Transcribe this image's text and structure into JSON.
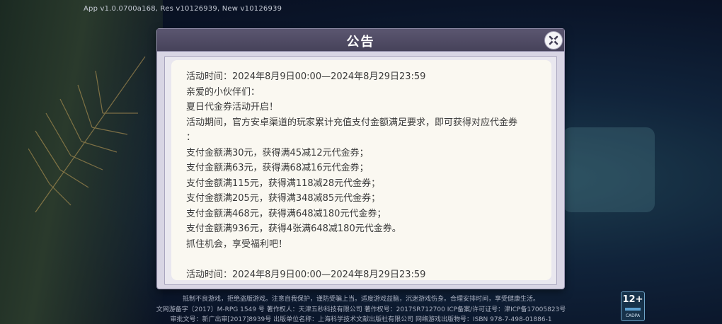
{
  "app": {
    "version_text": "App v1.0.0700a168, Res v10126939, New v10126939"
  },
  "dialog": {
    "title": "公告",
    "close_icon": "close-x-icon",
    "lines": [
      "活动时间：2024年8月9日00:00—2024年8月29日23:59",
      "亲爱的小伙伴们：",
      "夏日代金券活动开启！",
      "活动期间，官方安卓渠道的玩家累计充值支付金额满足要求，即可获得对应代金券",
      "：",
      "支付金额满30元，获得满45减12元代金券；",
      "支付金额满63元，获得满68减16元代金券；",
      "支付金额满115元，获得满118减28元代金券；",
      "支付金额满205元，获得满348减85元代金券；",
      "支付金额满468元，获得满648减180元代金券；",
      "支付金额满936元，获得4张满648减180元代金券。",
      "抓住机会，享受福利吧！",
      "",
      "活动时间：2024年8月9日00:00—2024年8月29日23:59"
    ]
  },
  "footer": {
    "line1": "抵制不良游戏，拒绝盗版游戏。注意自我保护，谨防受骗上当。适度游戏益脑，沉迷游戏伤身。合理安排时间，享受健康生活。",
    "line2": "文网游备字〔2017〕M-RPG 1549 号  著作权人：天津五秒科技有限公司  著作权号：2017SR712700  ICP备案/许可证号：津ICP备17005823号",
    "line3": "审批文号：新广出审[2017]8939号  出版单位名称：上海科学技术文献出版社有限公司  网络游戏出版物号：ISBN 978-7-498-01886-1",
    "age_rating": "12+",
    "age_sub": "CADPA"
  },
  "colors": {
    "header_bg": "#4f4a66",
    "panel_bg": "#faf8f1",
    "text": "#3a3a3a"
  }
}
